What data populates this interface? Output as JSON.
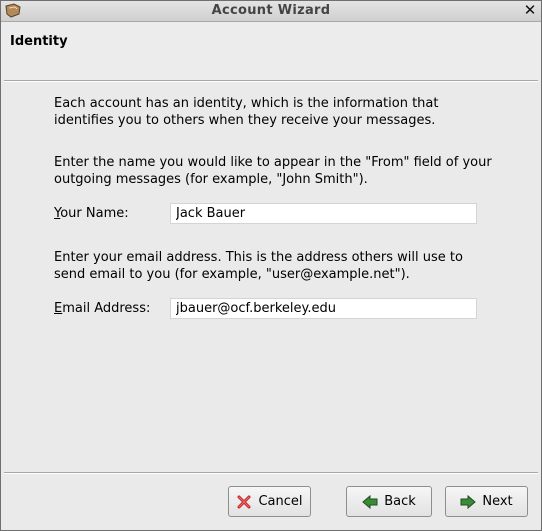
{
  "window": {
    "title": "Account Wizard"
  },
  "page": {
    "title": "Identity"
  },
  "intro": "Each account has an identity, which is the information that identifies you to others when they receive your messages.",
  "name_section": {
    "instructions": "Enter the name you would like to appear in the \"From\" field of your outgoing messages (for example, \"John Smith\").",
    "label_mnemonic": "Y",
    "label_rest": "our Name:",
    "value": "Jack Bauer"
  },
  "email_section": {
    "instructions": "Enter your email address. This is the address others will use to send email to you (for example, \"user@example.net\").",
    "label_mnemonic": "E",
    "label_rest": "mail Address:",
    "value": "jbauer@ocf.berkeley.edu"
  },
  "buttons": {
    "cancel": "Cancel",
    "back": "Back",
    "next": "Next"
  },
  "icons": {
    "app": "wizard-app-icon",
    "close": "close-icon",
    "cancel": "cancel-x-icon",
    "back": "arrow-left-icon",
    "next": "arrow-right-icon"
  },
  "colors": {
    "icon_green": "#3a8a3a",
    "icon_red": "#c02020"
  }
}
